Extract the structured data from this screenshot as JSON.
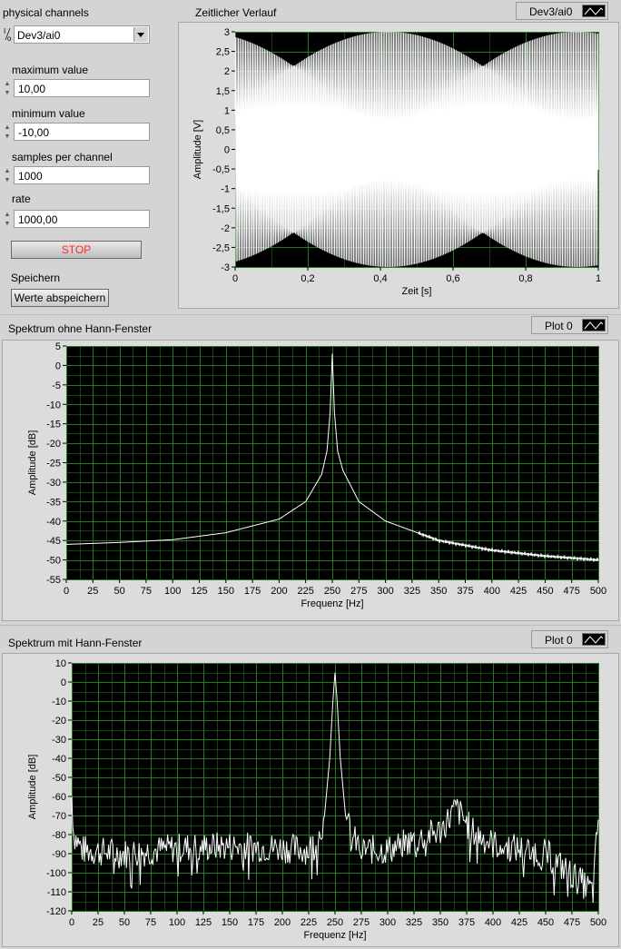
{
  "controls": {
    "physical_channels_label": "physical channels",
    "physical_channel_value": "Dev3/ai0",
    "channel_type_glyph": "I/O",
    "maximum_value_label": "maximum value",
    "maximum_value": "10,00",
    "minimum_value_label": "minimum value",
    "minimum_value": "-10,00",
    "samples_per_channel_label": "samples per channel",
    "samples_per_channel": "1000",
    "rate_label": "rate",
    "rate": "1000,00",
    "stop_label": "STOP",
    "speichern_label": "Speichern",
    "save_button_label": "Werte abspeichern",
    "stop_color": "#ff2a2a"
  },
  "time_graph": {
    "title": "Zeitlicher Verlauf",
    "legend": "Dev3/ai0"
  },
  "spectrum1": {
    "title": "Spektrum ohne Hann-Fenster",
    "legend": "Plot 0"
  },
  "spectrum2": {
    "title": "Spektrum mit Hann-Fenster",
    "legend": "Plot 0"
  },
  "colors": {
    "plot_background": "#000000",
    "grid": "#1f7a1f",
    "trace": "#ffffff",
    "panel": "#d4d4d4"
  },
  "chart_data": [
    {
      "type": "line",
      "title": "",
      "xlabel": "Zeit [s]",
      "ylabel": "Amplitude [V]",
      "xlim": [
        0,
        1
      ],
      "ylim": [
        -3,
        3
      ],
      "x_ticks": [
        "0",
        "0,2",
        "0,4",
        "0,6",
        "0,8",
        "1"
      ],
      "y_ticks": [
        "3",
        "2,5",
        "2",
        "1,5",
        "1",
        "0,5",
        "0",
        "-0,5",
        "-1",
        "-1,5",
        "-2",
        "-2,5",
        "-3"
      ],
      "series": [
        {
          "description_values": {
            "signal_frequency_hz": 250,
            "sample_rate_hz": 1000,
            "amplitude_v": 3
          }
        }
      ]
    },
    {
      "type": "line",
      "title": "",
      "xlabel": "Frequenz [Hz]",
      "ylabel": "Amplitude [dB]",
      "xlim": [
        0,
        500
      ],
      "ylim": [
        -55,
        5
      ],
      "x_ticks": [
        "0",
        "25",
        "50",
        "75",
        "100",
        "125",
        "150",
        "175",
        "200",
        "225",
        "250",
        "275",
        "300",
        "325",
        "350",
        "375",
        "400",
        "425",
        "450",
        "475",
        "500"
      ],
      "y_ticks": [
        "5",
        "0",
        "-5",
        "-10",
        "-15",
        "-20",
        "-25",
        "-30",
        "-35",
        "-40",
        "-45",
        "-50",
        "-55"
      ],
      "peak": {
        "x": 250,
        "y": 3
      },
      "series": [
        {
          "x": [
            0,
            50,
            100,
            150,
            200,
            225,
            240,
            245,
            248,
            250,
            252,
            255,
            260,
            275,
            300,
            350,
            400,
            450,
            500
          ],
          "values": [
            -46,
            -45.5,
            -44.8,
            -43,
            -39.5,
            -35,
            -28,
            -22,
            -12,
            3,
            -12,
            -22,
            -27,
            -35,
            -40,
            -45,
            -47.5,
            -49,
            -50
          ]
        }
      ]
    },
    {
      "type": "line",
      "title": "",
      "xlabel": "Frequenz [Hz]",
      "ylabel": "Amplitude [dB]",
      "xlim": [
        0,
        500
      ],
      "ylim": [
        -120,
        10
      ],
      "x_ticks": [
        "0",
        "25",
        "50",
        "75",
        "100",
        "125",
        "150",
        "175",
        "200",
        "225",
        "250",
        "275",
        "300",
        "325",
        "350",
        "375",
        "400",
        "425",
        "450",
        "475",
        "500"
      ],
      "y_ticks": [
        "10",
        "0",
        "-10",
        "-20",
        "-30",
        "-40",
        "-50",
        "-60",
        "-70",
        "-80",
        "-90",
        "-100",
        "-110",
        "-120"
      ],
      "peak": {
        "x": 250,
        "y": 5
      },
      "series": [
        {
          "x": [
            0,
            2,
            10,
            50,
            100,
            150,
            200,
            225,
            235,
            240,
            245,
            248,
            250,
            252,
            255,
            260,
            265,
            275,
            300,
            350,
            365,
            380,
            400,
            450,
            495,
            500
          ],
          "values": [
            -60,
            -80,
            -88,
            -90,
            -87,
            -86,
            -87,
            -88,
            -80,
            -70,
            -40,
            -10,
            5,
            -10,
            -40,
            -70,
            -80,
            -88,
            -88,
            -78,
            -66,
            -78,
            -85,
            -90,
            -110,
            -70
          ]
        }
      ]
    }
  ]
}
